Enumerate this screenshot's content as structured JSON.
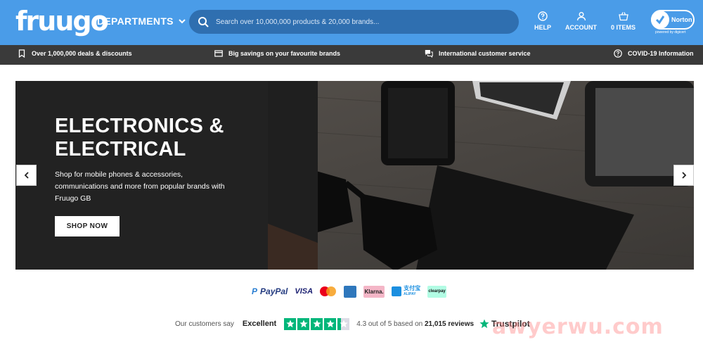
{
  "header": {
    "logo": "fruugo",
    "departments_label": "DEPARTMENTS",
    "search_placeholder": "Search over 10,000,000 products & 20,000 brands...",
    "help_label": "HELP",
    "account_label": "ACCOUNT",
    "basket_label": "0 ITEMS",
    "norton_label": "Norton",
    "norton_sub": "powered by digicert",
    "bg_color": "#4a9ce8"
  },
  "infobar": {
    "items": [
      {
        "icon": "bookmark-icon",
        "label": "Over 1,000,000 deals & discounts"
      },
      {
        "icon": "card-icon",
        "label": "Big savings on your favourite brands"
      },
      {
        "icon": "chat-icon",
        "label": "International customer service"
      },
      {
        "icon": "question-icon",
        "label": "COVID-19 Information"
      }
    ]
  },
  "hero": {
    "title": "ELECTRONICS & ELECTRICAL",
    "description": "Shop for mobile phones & accessories, communications and more from popular brands with Fruugo GB",
    "button_label": "SHOP NOW"
  },
  "payments": {
    "paypal": "PayPal",
    "visa": "VISA",
    "klarna": "Klarna.",
    "alipay": "支付宝",
    "alipay_sub": "ALIPAY",
    "clearpay": "clearpay"
  },
  "trust": {
    "intro": "Our customers say",
    "verdict": "Excellent",
    "score_text": "4.3 out of 5 based on",
    "reviews": "21,015 reviews",
    "brand": "Trustpilot",
    "rating": 4.3,
    "max_rating": 5
  },
  "watermark": "awyerwu.com"
}
